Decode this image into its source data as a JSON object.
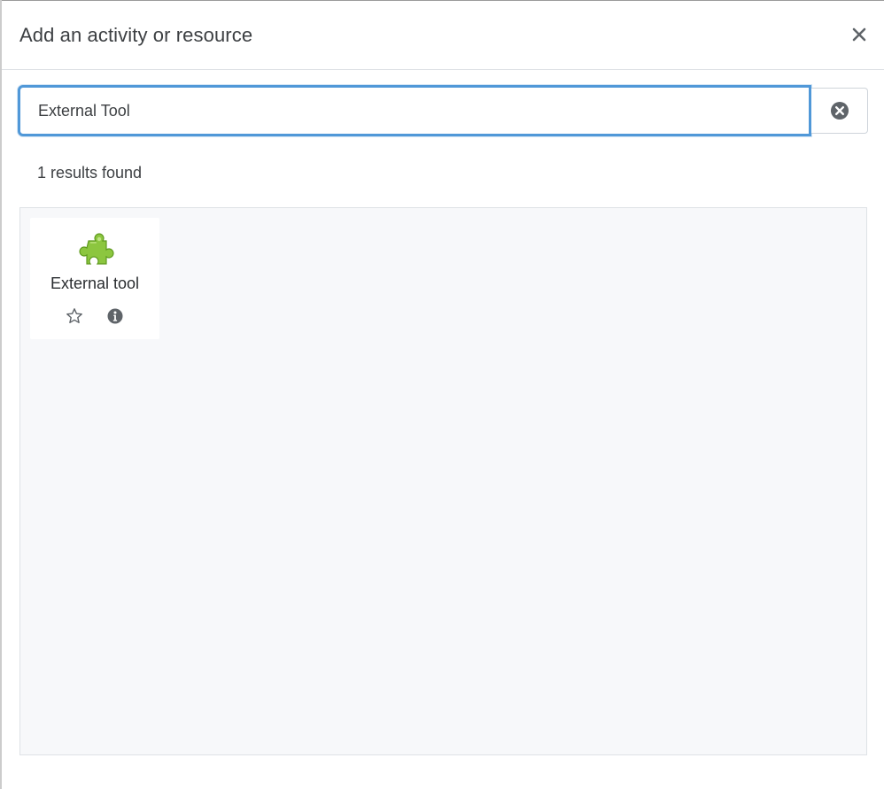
{
  "modal": {
    "title": "Add an activity or resource",
    "close_icon": "close-icon"
  },
  "search": {
    "value": "External Tool",
    "clear_icon": "clear-circle-x-icon"
  },
  "results": {
    "count_text": "1 results found",
    "items": [
      {
        "label": "External tool",
        "icon": "puzzle-piece-icon",
        "star_icon": "star-outline-icon",
        "info_icon": "info-circle-icon"
      }
    ]
  },
  "colors": {
    "focus_border": "#5098d8",
    "panel_background": "#f7f8fa",
    "puzzle_green": "#8cc63f",
    "icon_gray": "#5f6469"
  }
}
